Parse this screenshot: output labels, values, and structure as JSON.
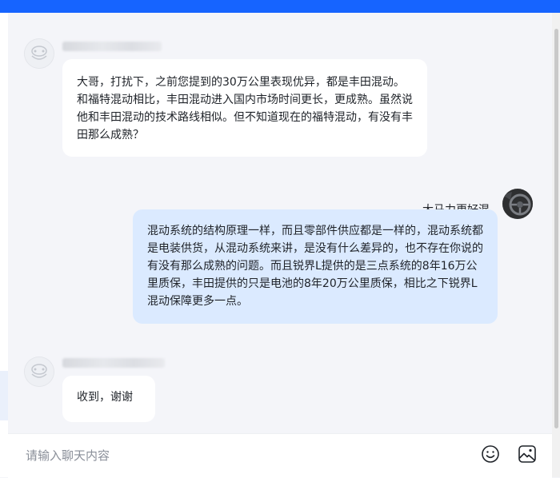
{
  "conversation": {
    "messages": [
      {
        "direction": "incoming",
        "text": "大哥，打扰下，之前您提到的30万公里表现优异，都是丰田混动。和福特混动相比，丰田混动进入国内市场时间更长，更成熟。虽然说他和丰田混动的技术路线相似。但不知道现在的福特混动，有没有丰田那么成熟？"
      },
      {
        "direction": "outgoing",
        "sender": "大马力更好混",
        "text": "混动系统的结构原理一样，而且零部件供应都是一样的，混动系统都是电装供货，从混动系统来讲，是没有什么差异的，也不存在你说的有没有那么成熟的问题。而且锐界L提供的是三点系统的8年16万公里质保，丰田提供的只是电池的8年20万公里质保，相比之下锐界L混动保障更多一点。"
      },
      {
        "direction": "incoming",
        "text": "收到，谢谢"
      }
    ]
  },
  "composer": {
    "placeholder": "请输入聊天内容",
    "emoji_icon": "smiley-icon",
    "image_icon": "image-icon"
  },
  "colors": {
    "accent": "#1664ff",
    "incoming_bubble": "#ffffff",
    "outgoing_bubble": "#dbeaff",
    "background": "#f4f5f9"
  }
}
